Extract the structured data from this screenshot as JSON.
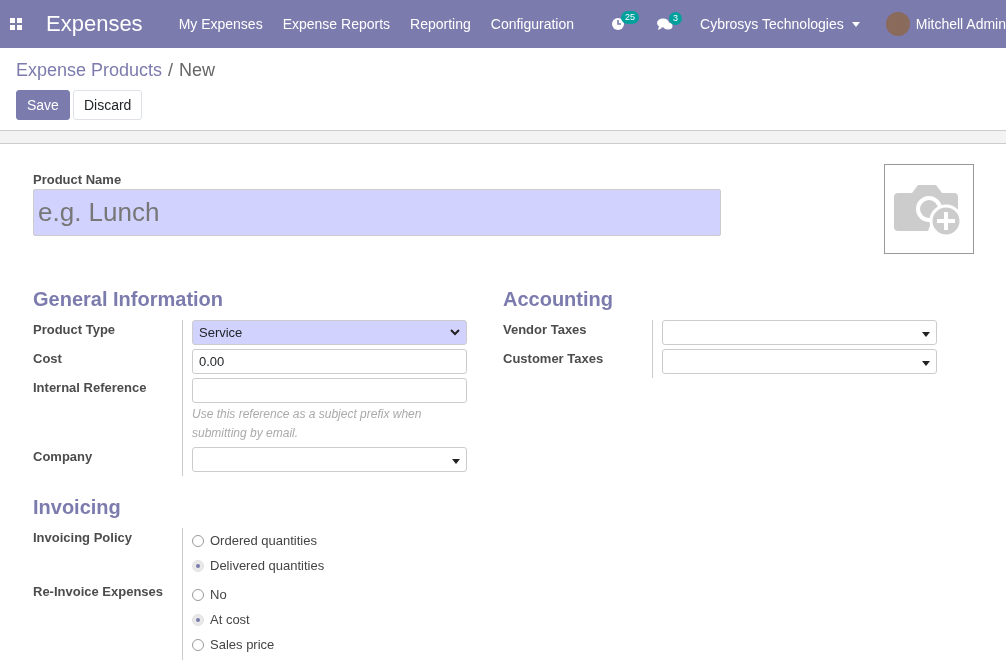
{
  "navbar": {
    "app_name": "Expenses",
    "menu": [
      "My Expenses",
      "Expense Reports",
      "Reporting",
      "Configuration"
    ],
    "activity_count": "25",
    "message_count": "3",
    "company": "Cybrosys Technologies",
    "user": "Mitchell Admin"
  },
  "breadcrumb": {
    "parent": "Expense Products",
    "separator": "/",
    "current": "New"
  },
  "buttons": [
    {
      "label": "Save",
      "kind": "primary"
    },
    {
      "label": "Discard",
      "kind": "secondary"
    }
  ],
  "product_name": {
    "label": "Product Name",
    "placeholder": "e.g. Lunch"
  },
  "groups": [
    {
      "title": "General Information",
      "fields": [
        {
          "kind": "select",
          "label": "Product Type",
          "value": "Service"
        },
        {
          "kind": "input",
          "label": "Cost",
          "value": "0.00"
        },
        {
          "kind": "input",
          "label": "Internal Reference",
          "help": "Use this reference as a subject prefix when submitting by email."
        },
        {
          "kind": "many2one",
          "label": "Company"
        }
      ]
    },
    {
      "title": "Accounting",
      "fields": [
        {
          "kind": "many2one",
          "label": "Vendor Taxes"
        },
        {
          "kind": "many2one",
          "label": "Customer Taxes"
        }
      ]
    }
  ],
  "invoicing": {
    "title": "Invoicing",
    "fields": [
      {
        "kind": "radio",
        "label": "Invoicing Policy",
        "options": [
          {
            "label": "Ordered quantities",
            "selected": false
          },
          {
            "label": "Delivered quantities",
            "selected": true
          }
        ]
      },
      {
        "kind": "radio",
        "label": "Re-Invoice Expenses",
        "options": [
          {
            "label": "No",
            "selected": false
          },
          {
            "label": "At cost",
            "selected": true
          },
          {
            "label": "Sales price",
            "selected": false
          }
        ]
      }
    ]
  }
}
